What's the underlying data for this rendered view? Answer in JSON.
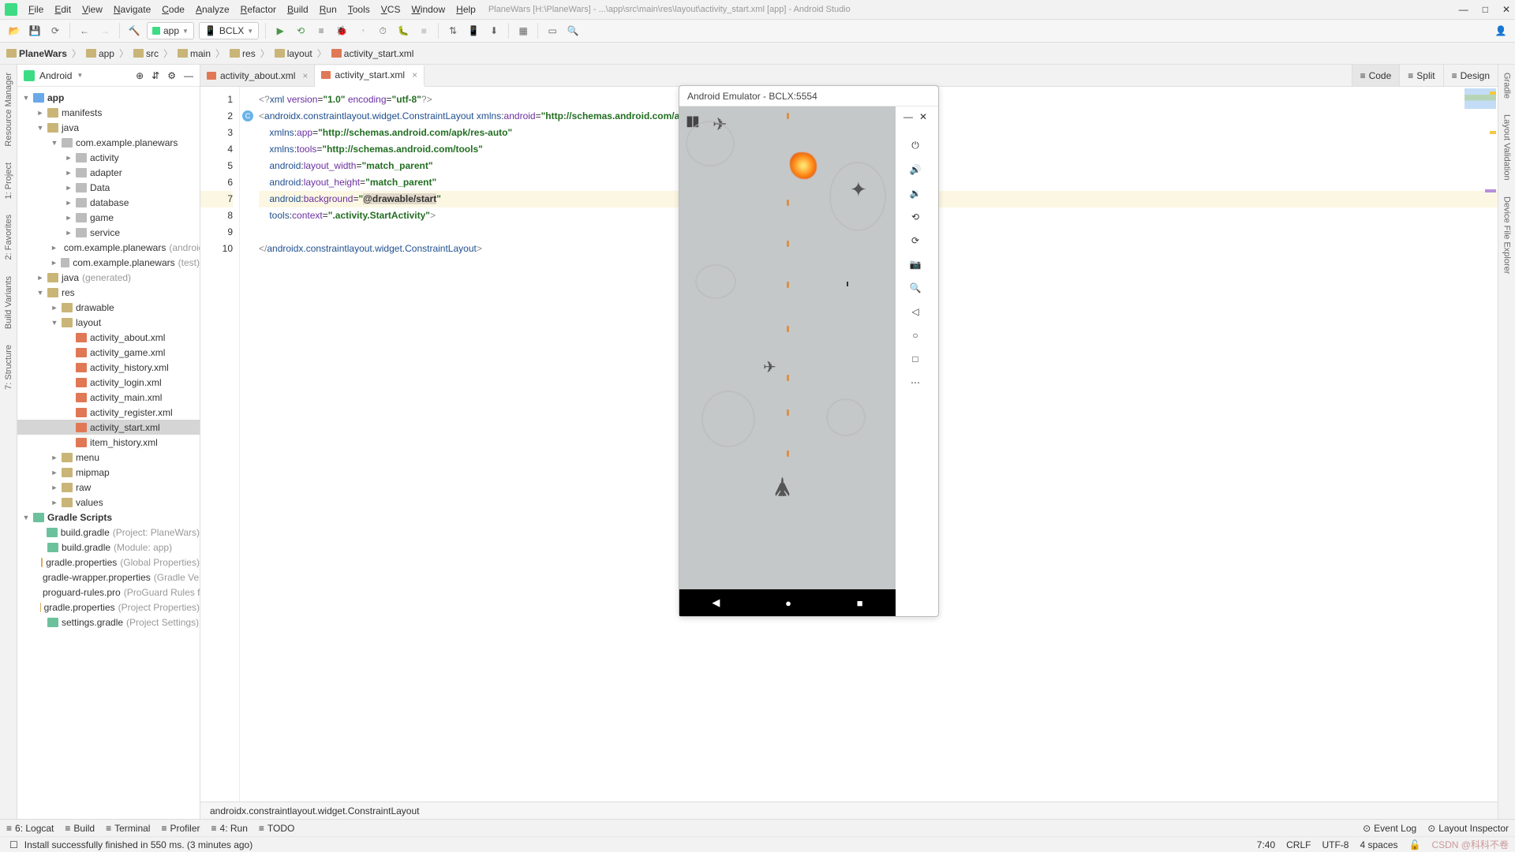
{
  "window": {
    "title_path": "PlaneWars [H:\\PlaneWars] - ...\\app\\src\\main\\res\\layout\\activity_start.xml [app] - Android Studio"
  },
  "menubar": [
    "File",
    "Edit",
    "View",
    "Navigate",
    "Code",
    "Analyze",
    "Refactor",
    "Build",
    "Run",
    "Tools",
    "VCS",
    "Window",
    "Help"
  ],
  "toolbar": {
    "config_app": "app",
    "device": "BCLX"
  },
  "breadcrumbs": [
    "PlaneWars",
    "app",
    "src",
    "main",
    "res",
    "layout",
    "activity_start.xml"
  ],
  "sidebar": {
    "title": "Android",
    "tree": [
      {
        "d": 0,
        "t": "app",
        "ico": "mod",
        "exp": true
      },
      {
        "d": 1,
        "t": "manifests",
        "ico": "dir",
        "exp": false,
        "arrow": "►"
      },
      {
        "d": 1,
        "t": "java",
        "ico": "dir",
        "exp": true
      },
      {
        "d": 2,
        "t": "com.example.planewars",
        "ico": "pkg",
        "exp": true
      },
      {
        "d": 3,
        "t": "activity",
        "ico": "pkg",
        "arrow": "►"
      },
      {
        "d": 3,
        "t": "adapter",
        "ico": "pkg",
        "arrow": "►"
      },
      {
        "d": 3,
        "t": "Data",
        "ico": "pkg",
        "arrow": "►"
      },
      {
        "d": 3,
        "t": "database",
        "ico": "pkg",
        "arrow": "►"
      },
      {
        "d": 3,
        "t": "game",
        "ico": "pkg",
        "arrow": "►"
      },
      {
        "d": 3,
        "t": "service",
        "ico": "pkg",
        "arrow": "►"
      },
      {
        "d": 2,
        "t": "com.example.planewars",
        "muted": "(androidTest)",
        "ico": "pkg",
        "arrow": "►"
      },
      {
        "d": 2,
        "t": "com.example.planewars",
        "muted": "(test)",
        "ico": "pkg",
        "arrow": "►"
      },
      {
        "d": 1,
        "t": "java",
        "muted": "(generated)",
        "ico": "dir",
        "arrow": "►"
      },
      {
        "d": 1,
        "t": "res",
        "ico": "dir",
        "exp": true
      },
      {
        "d": 2,
        "t": "drawable",
        "ico": "dir",
        "arrow": "►"
      },
      {
        "d": 2,
        "t": "layout",
        "ico": "dir",
        "exp": true
      },
      {
        "d": 3,
        "t": "activity_about.xml",
        "ico": "xml"
      },
      {
        "d": 3,
        "t": "activity_game.xml",
        "ico": "xml"
      },
      {
        "d": 3,
        "t": "activity_history.xml",
        "ico": "xml"
      },
      {
        "d": 3,
        "t": "activity_login.xml",
        "ico": "xml"
      },
      {
        "d": 3,
        "t": "activity_main.xml",
        "ico": "xml"
      },
      {
        "d": 3,
        "t": "activity_register.xml",
        "ico": "xml"
      },
      {
        "d": 3,
        "t": "activity_start.xml",
        "ico": "xml",
        "sel": true
      },
      {
        "d": 3,
        "t": "item_history.xml",
        "ico": "xml"
      },
      {
        "d": 2,
        "t": "menu",
        "ico": "dir",
        "arrow": "►"
      },
      {
        "d": 2,
        "t": "mipmap",
        "ico": "dir",
        "arrow": "►"
      },
      {
        "d": 2,
        "t": "raw",
        "ico": "dir",
        "arrow": "►"
      },
      {
        "d": 2,
        "t": "values",
        "ico": "dir",
        "arrow": "►"
      },
      {
        "d": 0,
        "t": "Gradle Scripts",
        "ico": "gradle",
        "exp": true
      },
      {
        "d": 1,
        "t": "build.gradle",
        "muted": "(Project: PlaneWars)",
        "ico": "gradle"
      },
      {
        "d": 1,
        "t": "build.gradle",
        "muted": "(Module: app)",
        "ico": "gradle"
      },
      {
        "d": 1,
        "t": "gradle.properties",
        "muted": "(Global Properties)",
        "ico": "prop"
      },
      {
        "d": 1,
        "t": "gradle-wrapper.properties",
        "muted": "(Gradle Version)",
        "ico": "prop"
      },
      {
        "d": 1,
        "t": "proguard-rules.pro",
        "muted": "(ProGuard Rules for app)",
        "ico": "prop"
      },
      {
        "d": 1,
        "t": "gradle.properties",
        "muted": "(Project Properties)",
        "ico": "prop"
      },
      {
        "d": 1,
        "t": "settings.gradle",
        "muted": "(Project Settings)",
        "ico": "gradle"
      }
    ]
  },
  "tabs": [
    {
      "label": "activity_about.xml",
      "active": false
    },
    {
      "label": "activity_start.xml",
      "active": true
    }
  ],
  "viewmodes": [
    {
      "label": "Code",
      "active": true
    },
    {
      "label": "Split",
      "active": false
    },
    {
      "label": "Design",
      "active": false
    }
  ],
  "editor": {
    "lines": 10,
    "highlighted_line": 7,
    "crumb": "androidx.constraintlayout.widget.ConstraintLayout",
    "xml": {
      "decl_version": "1.0",
      "decl_enc": "utf-8",
      "root": "androidx.constraintlayout.widget.ConstraintLayout",
      "xmlns_android": "http://schemas.android.com/apk/res/android",
      "xmlns_app": "http://schemas.android.com/apk/res-auto",
      "xmlns_tools": "http://schemas.android.com/tools",
      "layout_width": "match_parent",
      "layout_height": "match_parent",
      "background": "@drawable/start",
      "context": ".activity.StartActivity"
    }
  },
  "emulator": {
    "title": "Android Emulator - BCLX:5554"
  },
  "left_rail": [
    "Resource Manager",
    "1: Project",
    "2: Favorites",
    "Build Variants",
    "7: Structure"
  ],
  "right_rail": [
    "Gradle",
    "Layout Validation",
    "Device File Explorer"
  ],
  "bottombar": [
    "6: Logcat",
    "Build",
    "Terminal",
    "Profiler",
    "4: Run",
    "TODO"
  ],
  "bottombar_right": [
    "Event Log",
    "Layout Inspector"
  ],
  "status": {
    "msg": "Install successfully finished in 550 ms. (3 minutes ago)",
    "pos": "7:40",
    "eol": "CRLF",
    "enc": "UTF-8",
    "indent": "4 spaces"
  }
}
